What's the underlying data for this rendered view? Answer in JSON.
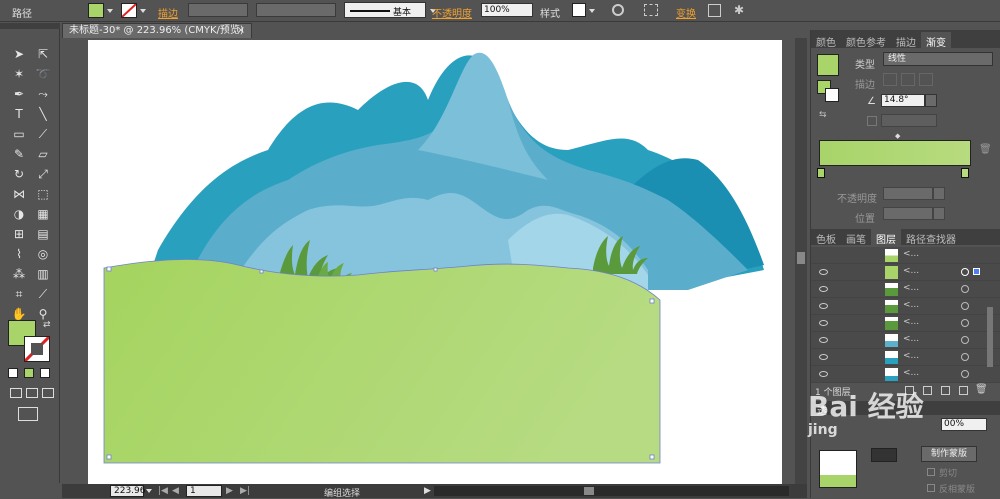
{
  "control_bar": {
    "selection_type": "路径",
    "stroke_label": "描边",
    "stroke_style": "基本",
    "opacity_label": "不透明度",
    "opacity_value": "100%",
    "style_label": "样式",
    "transform_label": "变换",
    "fill_color": "#a8d46a"
  },
  "document_tab": {
    "title": "未标题-30* @ 223.96% (CMYK/预览)",
    "close_glyph": "×"
  },
  "status_bar": {
    "zoom": "223.96",
    "page": "1",
    "status_text": "编组选择"
  },
  "panel_top": {
    "tabs": [
      "颜色",
      "颜色参考",
      "描边",
      "渐变"
    ],
    "active_tab": "渐变",
    "type_label": "类型",
    "type_value": "线性",
    "stroke_label": "描边",
    "angle_value": "14.8°",
    "opacity_label": "不透明度",
    "location_label": "位置",
    "gradient_start": "#a8d46a",
    "gradient_end": "#b7db7e"
  },
  "panel_layers": {
    "tabs": [
      "色板",
      "画笔",
      "图层",
      "路径查找器"
    ],
    "active_tab": "图层",
    "row_names": [
      "<...",
      "<...",
      "<...",
      "<...",
      "<...",
      "<...",
      "<...",
      "<..."
    ],
    "footer_text": "1 个图层"
  },
  "panel_bottom": {
    "tab_fragment": "透",
    "opacity_value": "00%",
    "make_mask_button": "制作蒙版",
    "invert_mask_label": "反相蒙版",
    "clip_label": "剪切"
  },
  "watermark": {
    "text": "Bai 经验",
    "subtext": "jing"
  },
  "tool_colors": {
    "fill": "#a8d46a",
    "mountain_dark": "#2aa0bf",
    "mountain_mid": "#5cb0cc",
    "mountain_light": "#92cde2",
    "ground": "#a9d66a",
    "grass": "#5a9a3c"
  }
}
